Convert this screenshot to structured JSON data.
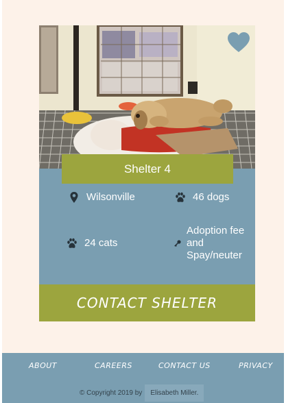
{
  "shelter": {
    "name": "Shelter 4",
    "location": "Wilsonville",
    "dogs": "46 dogs",
    "cats": "24 cats",
    "fee": "Adoption fee and Spay/neuter",
    "contact_label": "CONTACT SHELTER",
    "favorited": true
  },
  "icons": {
    "favorite": "heart-icon",
    "location": "map-pin-icon",
    "dogs": "paw-icon",
    "cats": "paw-icon",
    "fee": "key-icon"
  },
  "footer": {
    "nav": [
      "ABOUT",
      "CAREERS",
      "CONTACT US",
      "PRIVACY"
    ],
    "copyright": "© Copyright 2019 by",
    "author": "Elisabeth Miller."
  },
  "colors": {
    "page_bg": "#fdf2e9",
    "card_blue": "#7a9eb1",
    "olive": "#9ca53e",
    "heart": "#7a9eb1"
  }
}
